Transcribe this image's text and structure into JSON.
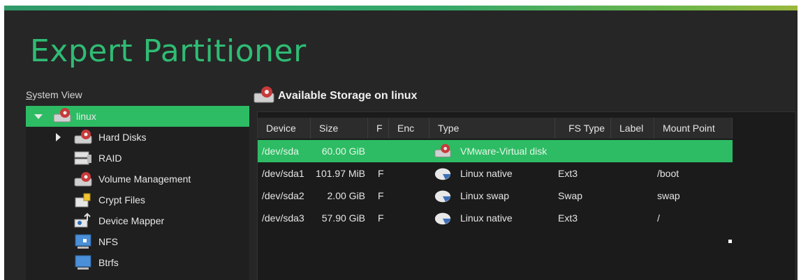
{
  "title": "Expert Partitioner",
  "system_view": {
    "label_prefix": "S",
    "label_rest": "ystem View",
    "items": [
      {
        "label": "linux",
        "icon": "harddisk-icon",
        "expanded": true,
        "selected": true
      },
      {
        "label": "Hard Disks",
        "icon": "harddisk-icon",
        "expandable": true
      },
      {
        "label": "RAID",
        "icon": "raid-icon"
      },
      {
        "label": "Volume Management",
        "icon": "harddisk-icon"
      },
      {
        "label": "Crypt Files",
        "icon": "crypt-files-icon"
      },
      {
        "label": "Device Mapper",
        "icon": "device-mapper-icon"
      },
      {
        "label": "NFS",
        "icon": "nfs-icon"
      },
      {
        "label": "Btrfs",
        "icon": "btrfs-icon"
      }
    ]
  },
  "panel": {
    "title": "Available Storage on linux",
    "columns": [
      "Device",
      "Size",
      "F",
      "Enc",
      "Type",
      "FS Type",
      "Label",
      "Mount Point"
    ],
    "rows": [
      {
        "device": "/dev/sda",
        "size": "60.00 GiB",
        "f": "",
        "enc": "",
        "type": "VMware-Virtual disk",
        "type_icon": "harddisk-icon",
        "fs_type": "",
        "label": "",
        "mount": "",
        "selected": true
      },
      {
        "device": "/dev/sda1",
        "size": "101.97 MiB",
        "f": "F",
        "enc": "",
        "type": "Linux native",
        "type_icon": "partition-icon",
        "fs_type": "Ext3",
        "label": "",
        "mount": "/boot"
      },
      {
        "device": "/dev/sda2",
        "size": "2.00 GiB",
        "f": "F",
        "enc": "",
        "type": "Linux swap",
        "type_icon": "partition-icon",
        "fs_type": "Swap",
        "label": "",
        "mount": "swap"
      },
      {
        "device": "/dev/sda3",
        "size": "57.90 GiB",
        "f": "F",
        "enc": "",
        "type": "Linux native",
        "type_icon": "partition-icon",
        "fs_type": "Ext3",
        "label": "",
        "mount": "/"
      }
    ]
  },
  "colors": {
    "accent": "#2dbc64",
    "title": "#2fbc74",
    "background": "#262626"
  }
}
